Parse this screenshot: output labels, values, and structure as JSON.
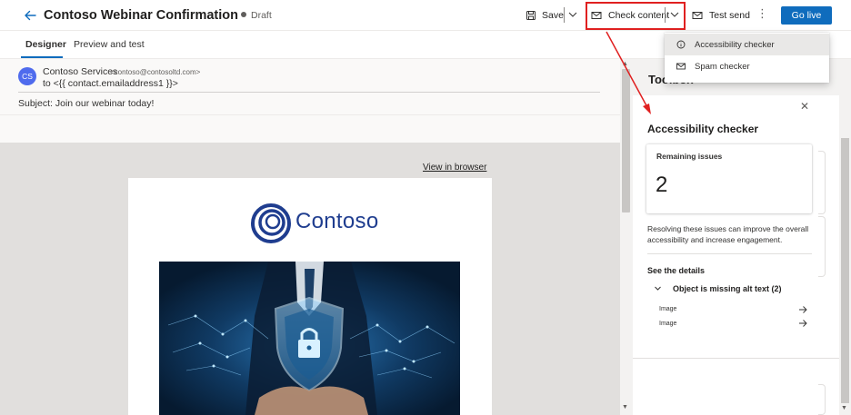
{
  "header": {
    "title": "Contoso Webinar Confirmation",
    "status": "Draft",
    "save_label": "Save",
    "check_content_label": "Check content",
    "test_send_label": "Test send",
    "more_label": "⋮",
    "go_live_label": "Go live"
  },
  "tabs": [
    {
      "label": "Designer",
      "active": true
    },
    {
      "label": "Preview and test",
      "active": false
    }
  ],
  "dropdown": {
    "items": [
      {
        "label": "Accessibility checker",
        "icon": "info-icon"
      },
      {
        "label": "Spam checker",
        "icon": "mail-icon"
      }
    ]
  },
  "email": {
    "avatar_initials": "CS",
    "sender_name": "Contoso Services",
    "sender_email": "<contoso@contosoltd.com>",
    "to": "to <{{ contact.emailaddress1 }}>",
    "subject_key": "Subject:",
    "subject_value": " Join our webinar today!",
    "view_in_browser": "View in browser",
    "logo_text": "Contoso"
  },
  "toolbox": {
    "title": "Toolbox",
    "panel_title": "Accessibility checker",
    "remaining_label": "Remaining issues",
    "remaining_count": "2",
    "description": "Resolving these issues can improve the overall accessibility and increase engagement.",
    "details_label": "See the details",
    "issue_group": "Object is missing alt text (2)",
    "issue_items": [
      "Image",
      "Image"
    ]
  },
  "colors": {
    "accent": "#0f6cbd",
    "highlight": "#e02020",
    "avatar": "#4f6bed",
    "logo": "#1f3d8f"
  }
}
